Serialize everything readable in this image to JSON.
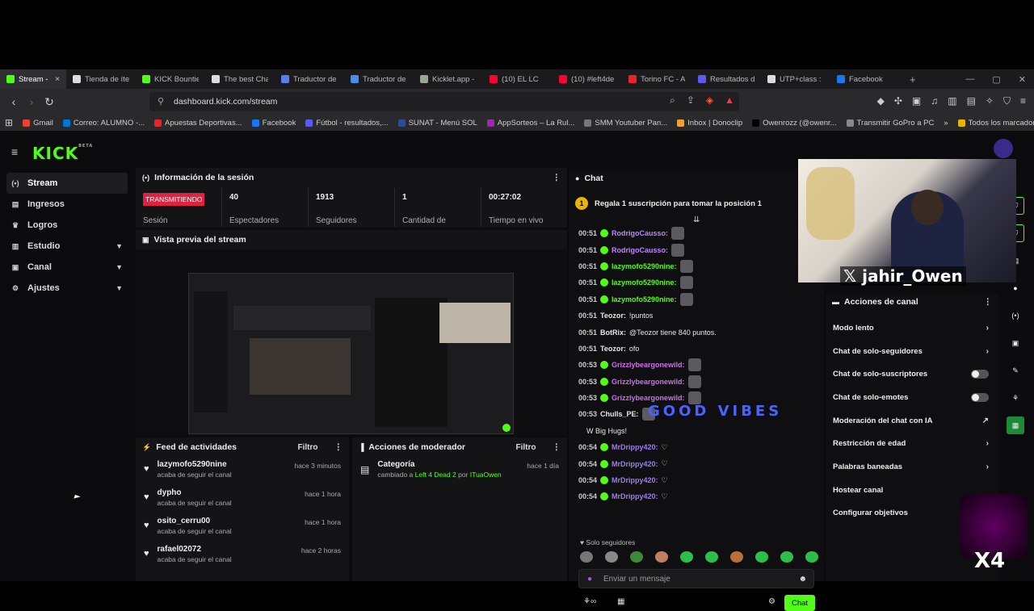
{
  "browser": {
    "tabs": [
      {
        "label": "Stream - ",
        "color": "#53fc18",
        "icon": "kick-icon"
      },
      {
        "label": "Tienda de íte",
        "color": "#dddddd",
        "icon": "diamond-icon"
      },
      {
        "label": "KICK Bountie",
        "color": "#53fc18",
        "icon": "kick-icon"
      },
      {
        "label": "The best Cha",
        "color": "#dddddd",
        "icon": "diamond-icon"
      },
      {
        "label": "Traductor de",
        "color": "#5b7cf0",
        "icon": "translate-icon"
      },
      {
        "label": "Traductor de",
        "color": "#4a90e2",
        "icon": "translate-icon"
      },
      {
        "label": "Kicklet.app -",
        "color": "#9aa59a",
        "icon": "kicklet-icon"
      },
      {
        "label": "(10) EL LC",
        "color": "#ff0033",
        "icon": "youtube-icon"
      },
      {
        "label": "(10) #left4de",
        "color": "#ff0033",
        "icon": "youtube-icon"
      },
      {
        "label": "Torino FC - A",
        "color": "#e8232e",
        "icon": "torino-icon"
      },
      {
        "label": "Resultados d",
        "color": "#5b5bf0",
        "icon": "results-icon"
      },
      {
        "label": "UTP+class :",
        "color": "#dddddd",
        "icon": "utp-icon"
      },
      {
        "label": "Facebook",
        "color": "#1877f2",
        "icon": "facebook-icon"
      }
    ],
    "tab_close": "×",
    "new_tab": "+",
    "url": "dashboard.kick.com/stream",
    "bookmarks": [
      {
        "label": "Gmail",
        "color": "#ea4335"
      },
      {
        "label": "Correo: ALUMNO -...",
        "color": "#0078d4"
      },
      {
        "label": "Apuestas Deportivas...",
        "color": "#e8232e"
      },
      {
        "label": "Facebook",
        "color": "#1877f2"
      },
      {
        "label": "Fútbol - resultados,...",
        "color": "#5b5bf0"
      },
      {
        "label": "SUNAT - Menú SOL",
        "color": "#2a4d9b"
      },
      {
        "label": "AppSorteos – La Rul...",
        "color": "#9c27b0"
      },
      {
        "label": "SMM Youtuber Pan...",
        "color": "#777777"
      },
      {
        "label": "Inbox | Donoclip",
        "color": "#f0a030"
      },
      {
        "label": "Owenrozz (@owenr...",
        "color": "#000000"
      },
      {
        "label": "Transmitir GoPro a PC",
        "color": "#888888"
      }
    ],
    "bookmarks_more": "»",
    "all_bookmarks": "Todos los marcadores"
  },
  "app": {
    "logo": "KICK",
    "logo_tag": "BETA",
    "sidebar": [
      {
        "label": "Stream",
        "icon": "stream-icon",
        "glyph": "(•)",
        "expand": false
      },
      {
        "label": "Ingresos",
        "icon": "income-icon",
        "glyph": "▤",
        "expand": false
      },
      {
        "label": "Logros",
        "icon": "trophy-icon",
        "glyph": "♛",
        "expand": false
      },
      {
        "label": "Estudio",
        "icon": "studio-icon",
        "glyph": "▥",
        "expand": true
      },
      {
        "label": "Canal",
        "icon": "channel-icon",
        "glyph": "▣",
        "expand": true
      },
      {
        "label": "Ajustes",
        "icon": "gear-icon",
        "glyph": "⚙",
        "expand": true
      }
    ],
    "session": {
      "title": "Información de la sesión",
      "badge": "TRANSMITIENDO",
      "badge_label": "Sesión",
      "stats": [
        {
          "value": "40",
          "label": "Espectadores"
        },
        {
          "value": "1913",
          "label": "Seguidores"
        },
        {
          "value": "1",
          "label": "Cantidad de"
        },
        {
          "value": "00:27:02",
          "label": "Tiempo en vivo"
        }
      ]
    },
    "preview_title": "Vista previa del stream",
    "feed": {
      "title": "Feed de actividades",
      "filter": "Filtro",
      "items": [
        {
          "name": "lazymofo5290nine",
          "sub": "acaba de seguir el canal",
          "time": "hace 3 minutos"
        },
        {
          "name": "dypho",
          "sub": "acaba de seguir el canal",
          "time": "hace 1 hora"
        },
        {
          "name": "osito_cerru00",
          "sub": "acaba de seguir el canal",
          "time": "hace 1 hora"
        },
        {
          "name": "rafael02072",
          "sub": "acaba de seguir el canal",
          "time": "hace 2 horas"
        }
      ]
    },
    "modactions": {
      "title": "Acciones de moderador",
      "filter": "Filtro",
      "item_title": "Categoría",
      "item_sub_prefix": "cambiado a",
      "item_game": "Left 4 Dead 2",
      "item_sub_mid": "por",
      "item_user": "ITuaOwen",
      "item_time": "hace 1 día"
    },
    "chat": {
      "title": "Chat",
      "pinned": "Regala 1 suscripción para tomar la posición 1",
      "messages": [
        {
          "time": "00:51",
          "user": "RodrigoCausso:",
          "color": "#c084fc",
          "text": ""
        },
        {
          "time": "00:51",
          "user": "RodrigoCausso:",
          "color": "#c084fc",
          "text": ""
        },
        {
          "time": "00:51",
          "user": "lazymofo5290nine:",
          "color": "#53fc18",
          "text": ""
        },
        {
          "time": "00:51",
          "user": "lazymofo5290nine:",
          "color": "#53fc18",
          "text": ""
        },
        {
          "time": "00:51",
          "user": "lazymofo5290nine:",
          "color": "#53fc18",
          "text": ""
        },
        {
          "time": "00:51",
          "user": "Teozor:",
          "color": "#e8e8e8",
          "text": "!puntos"
        },
        {
          "time": "00:51",
          "user": "BotRix:",
          "color": "#e8e8e8",
          "text": "@Teozor tiene 840 puntos."
        },
        {
          "time": "00:51",
          "user": "Teozor:",
          "color": "#e8e8e8",
          "text": "ofo"
        },
        {
          "time": "00:53",
          "user": "Grizzlybeargonewild:",
          "color": "#d06cf0",
          "text": ""
        },
        {
          "time": "00:53",
          "user": "Grizzlybeargonewild:",
          "color": "#d06cf0",
          "text": ""
        },
        {
          "time": "00:53",
          "user": "Grizzlybeargonewild:",
          "color": "#d06cf0",
          "text": ""
        },
        {
          "time": "00:53",
          "user": "Chulls_PE:",
          "color": "#e8e8e8",
          "text": ""
        },
        {
          "time": "",
          "user": "",
          "color": "#e8e8e8",
          "text": "W Big Hugs!"
        },
        {
          "time": "00:54",
          "user": "MrDrippy420:",
          "color": "#9d7cf5",
          "text": "♡"
        },
        {
          "time": "00:54",
          "user": "MrDrippy420:",
          "color": "#9d7cf5",
          "text": "♡"
        },
        {
          "time": "00:54",
          "user": "MrDrippy420:",
          "color": "#9d7cf5",
          "text": "♡"
        },
        {
          "time": "00:54",
          "user": "MrDrippy420:",
          "color": "#9d7cf5",
          "text": "♡"
        }
      ],
      "good_vibes": "GOOD VIBES",
      "followers_only": "Solo seguidores",
      "input_placeholder": "Enviar un mensaje",
      "send": "Chat"
    },
    "overlay_handle": "jahir_Owen",
    "overlay_x4": "X4",
    "actions": {
      "title": "Acciones de canal",
      "items": [
        {
          "label": "Modo lento",
          "control": "chevron"
        },
        {
          "label": "Chat de solo-seguidores",
          "control": "chevron"
        },
        {
          "label": "Chat de solo-suscriptores",
          "control": "toggle"
        },
        {
          "label": "Chat de solo-emotes",
          "control": "toggle"
        },
        {
          "label": "Moderación del chat con IA",
          "control": "link"
        },
        {
          "label": "Restricción de edad",
          "control": "chevron"
        },
        {
          "label": "Palabras baneadas",
          "control": "chevron"
        },
        {
          "label": "Hostear canal",
          "control": "none"
        },
        {
          "label": "Configurar objetivos",
          "control": "none"
        }
      ]
    }
  }
}
